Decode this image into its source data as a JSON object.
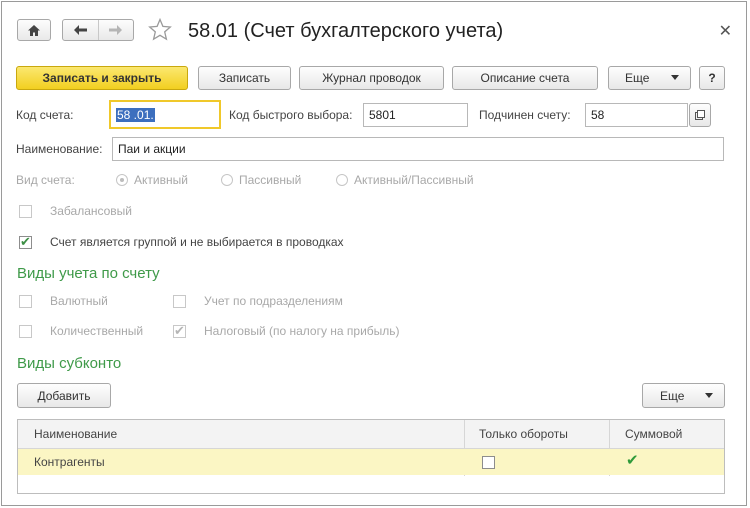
{
  "window": {
    "title": "58.01 (Счет бухгалтерского учета)",
    "close_icon": "close-icon",
    "home_icon": "home-icon",
    "back_icon": "arrow-left-icon",
    "forward_icon": "arrow-right-icon",
    "favorite_icon": "star-icon"
  },
  "toolbar": {
    "save_close": "Записать и закрыть",
    "save": "Записать",
    "journal": "Журнал проводок",
    "description": "Описание счета",
    "more": "Еще",
    "help": "?"
  },
  "fields": {
    "account_code_label": "Код счета:",
    "account_code_value": "58 .01.",
    "quick_code_label": "Код быстрого выбора:",
    "quick_code_value": "5801",
    "parent_label": "Подчинен счету:",
    "parent_value": "58",
    "name_label": "Наименование:",
    "name_value": "Паи и акции"
  },
  "account_type": {
    "label": "Вид счета:",
    "options": [
      "Активный",
      "Пассивный",
      "Активный/Пассивный"
    ],
    "selected": "Активный"
  },
  "flags": {
    "off_balance": "Забалансовый",
    "is_group": "Счет является группой и не выбирается в проводках",
    "is_group_checked": true
  },
  "accounting_types": {
    "heading": "Виды учета по счету",
    "currency": "Валютный",
    "by_division": "Учет по подразделениям",
    "quantity": "Количественный",
    "tax": "Налоговый (по налогу на прибыль)",
    "tax_checked": true
  },
  "subconto": {
    "heading": "Виды субконто",
    "add_button": "Добавить",
    "more_button": "Еще",
    "columns": [
      "Наименование",
      "Только обороты",
      "Суммовой"
    ],
    "rows": [
      {
        "name": "Контрагенты",
        "turnover_only": false,
        "summary": true
      }
    ]
  }
}
